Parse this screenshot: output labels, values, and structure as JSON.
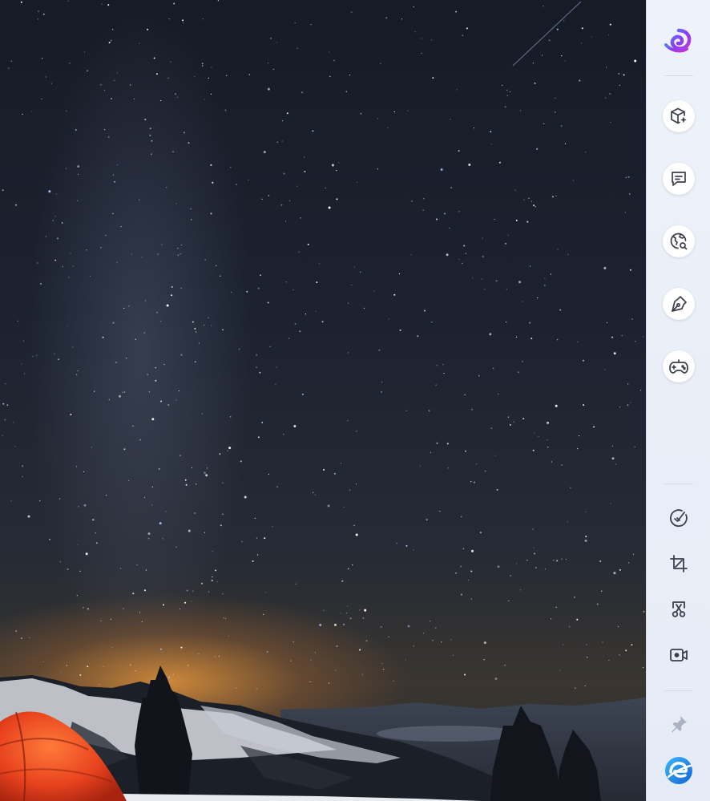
{
  "sidebar": {
    "logo_icon": "swirl-logo-icon",
    "items": [
      {
        "name": "3d-box-sparkle",
        "icon": "cube-sparkle-icon"
      },
      {
        "name": "chat",
        "icon": "chat-bubble-icon"
      },
      {
        "name": "global-search",
        "icon": "globe-search-icon"
      },
      {
        "name": "writing",
        "icon": "pen-nib-icon"
      },
      {
        "name": "game",
        "icon": "gamepad-icon"
      }
    ],
    "tools": [
      {
        "name": "speed-check",
        "icon": "gauge-check-icon"
      },
      {
        "name": "crop",
        "icon": "crop-icon"
      },
      {
        "name": "screenshot-cut",
        "icon": "scissors-screen-icon"
      },
      {
        "name": "screen-record",
        "icon": "video-record-icon"
      }
    ],
    "pin_icon": "pin-icon",
    "browser_icon": "browser-e-icon"
  },
  "colors": {
    "accent": "#7a3cf0",
    "browser_blue": "#1f8fe6",
    "icon_stroke": "#3a3f4b",
    "tent_red": "#e8431e"
  }
}
